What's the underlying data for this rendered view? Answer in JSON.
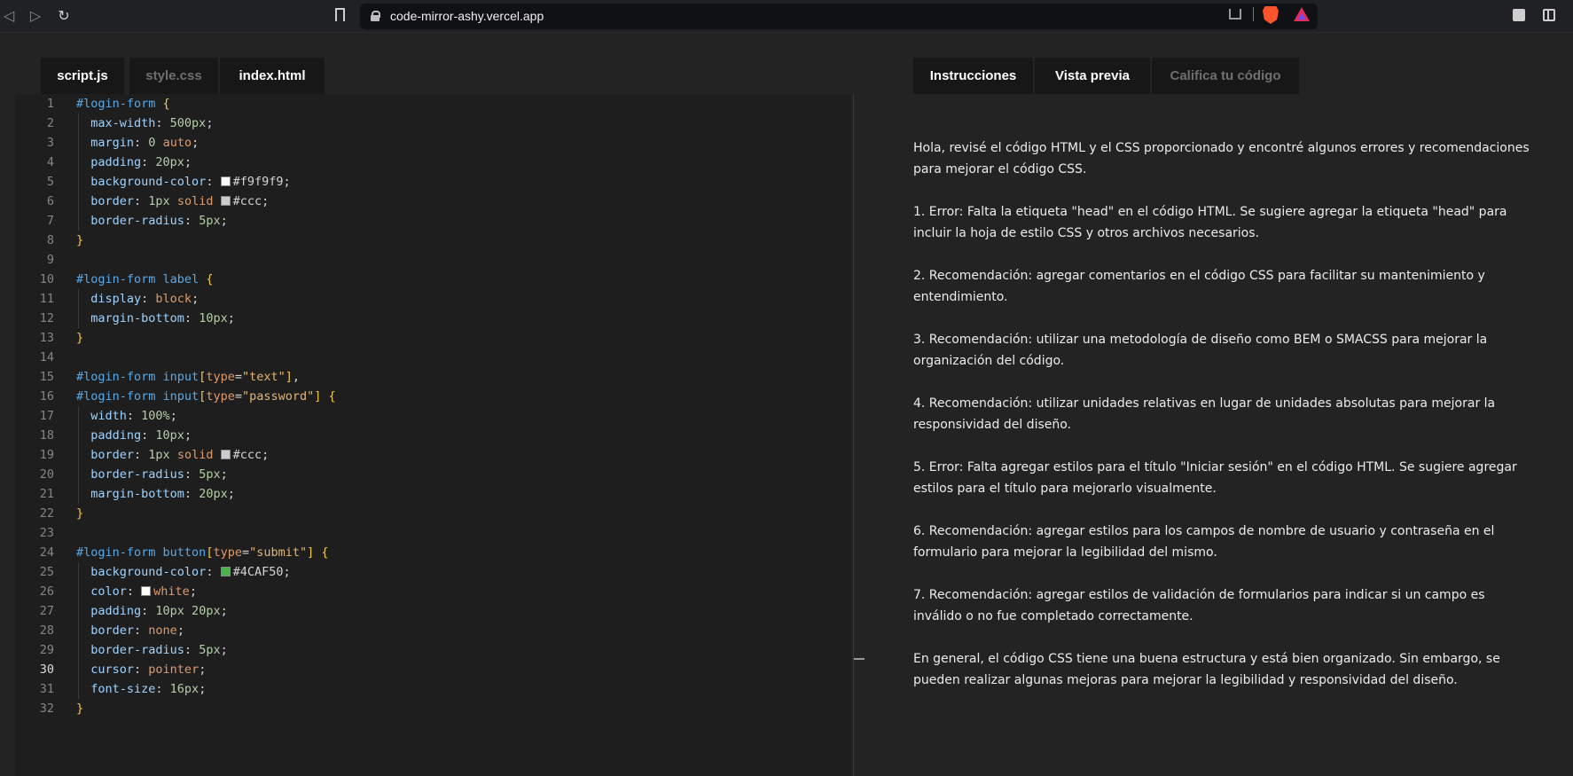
{
  "browser": {
    "url": "code-mirror-ashy.vercel.app"
  },
  "editor_tabs": [
    {
      "label": "script.js",
      "active": true
    },
    {
      "label": "style.css",
      "active": false
    },
    {
      "label": "index.html",
      "active": true
    }
  ],
  "editor": {
    "active_line": 30,
    "lines": [
      [
        [
          "sel",
          "#login-form "
        ],
        [
          "brace",
          "{"
        ]
      ],
      [
        [
          "prop",
          "  max-width"
        ],
        [
          "plain",
          ": "
        ],
        [
          "num",
          "500px"
        ],
        [
          "plain",
          ";"
        ]
      ],
      [
        [
          "prop",
          "  margin"
        ],
        [
          "plain",
          ": "
        ],
        [
          "num",
          "0 "
        ],
        [
          "kw",
          "auto"
        ],
        [
          "plain",
          ";"
        ]
      ],
      [
        [
          "prop",
          "  padding"
        ],
        [
          "plain",
          ": "
        ],
        [
          "num",
          "20px"
        ],
        [
          "plain",
          ";"
        ]
      ],
      [
        [
          "prop",
          "  background-color"
        ],
        [
          "plain",
          ": "
        ],
        [
          "swatch",
          "#f9f9f9"
        ],
        [
          "plain",
          "#f9f9f9;"
        ]
      ],
      [
        [
          "prop",
          "  border"
        ],
        [
          "plain",
          ": "
        ],
        [
          "num",
          "1px "
        ],
        [
          "kw",
          "solid "
        ],
        [
          "swatch",
          "#cccccc"
        ],
        [
          "plain",
          "#ccc;"
        ]
      ],
      [
        [
          "prop",
          "  border-radius"
        ],
        [
          "plain",
          ": "
        ],
        [
          "num",
          "5px"
        ],
        [
          "plain",
          ";"
        ]
      ],
      [
        [
          "brace",
          "}"
        ]
      ],
      [],
      [
        [
          "sel",
          "#login-form label "
        ],
        [
          "brace",
          "{"
        ]
      ],
      [
        [
          "prop",
          "  display"
        ],
        [
          "plain",
          ": "
        ],
        [
          "kw",
          "block"
        ],
        [
          "plain",
          ";"
        ]
      ],
      [
        [
          "prop",
          "  margin-bottom"
        ],
        [
          "plain",
          ": "
        ],
        [
          "num",
          "10px"
        ],
        [
          "plain",
          ";"
        ]
      ],
      [
        [
          "brace",
          "}"
        ]
      ],
      [],
      [
        [
          "sel",
          "#login-form input"
        ],
        [
          "brace",
          "["
        ],
        [
          "kw",
          "type"
        ],
        [
          "plain",
          "="
        ],
        [
          "str",
          "\"text\""
        ],
        [
          "brace",
          "]"
        ],
        [
          "plain",
          ","
        ]
      ],
      [
        [
          "sel",
          "#login-form input"
        ],
        [
          "brace",
          "["
        ],
        [
          "kw",
          "type"
        ],
        [
          "plain",
          "="
        ],
        [
          "str",
          "\"password\""
        ],
        [
          "brace",
          "] {"
        ]
      ],
      [
        [
          "prop",
          "  width"
        ],
        [
          "plain",
          ": "
        ],
        [
          "num",
          "100%"
        ],
        [
          "plain",
          ";"
        ]
      ],
      [
        [
          "prop",
          "  padding"
        ],
        [
          "plain",
          ": "
        ],
        [
          "num",
          "10px"
        ],
        [
          "plain",
          ";"
        ]
      ],
      [
        [
          "prop",
          "  border"
        ],
        [
          "plain",
          ": "
        ],
        [
          "num",
          "1px "
        ],
        [
          "kw",
          "solid "
        ],
        [
          "swatch",
          "#cccccc"
        ],
        [
          "plain",
          "#ccc;"
        ]
      ],
      [
        [
          "prop",
          "  border-radius"
        ],
        [
          "plain",
          ": "
        ],
        [
          "num",
          "5px"
        ],
        [
          "plain",
          ";"
        ]
      ],
      [
        [
          "prop",
          "  margin-bottom"
        ],
        [
          "plain",
          ": "
        ],
        [
          "num",
          "20px"
        ],
        [
          "plain",
          ";"
        ]
      ],
      [
        [
          "brace",
          "}"
        ]
      ],
      [],
      [
        [
          "sel",
          "#login-form button"
        ],
        [
          "brace",
          "["
        ],
        [
          "kw",
          "type"
        ],
        [
          "plain",
          "="
        ],
        [
          "str",
          "\"submit\""
        ],
        [
          "brace",
          "] {"
        ]
      ],
      [
        [
          "prop",
          "  background-color"
        ],
        [
          "plain",
          ": "
        ],
        [
          "swatch",
          "#4CAF50"
        ],
        [
          "plain",
          "#4CAF50;"
        ]
      ],
      [
        [
          "prop",
          "  color"
        ],
        [
          "plain",
          ": "
        ],
        [
          "swatch",
          "#ffffff"
        ],
        [
          "kw",
          "white"
        ],
        [
          "plain",
          ";"
        ]
      ],
      [
        [
          "prop",
          "  padding"
        ],
        [
          "plain",
          ": "
        ],
        [
          "num",
          "10px 20px"
        ],
        [
          "plain",
          ";"
        ]
      ],
      [
        [
          "prop",
          "  border"
        ],
        [
          "plain",
          ": "
        ],
        [
          "kw",
          "none"
        ],
        [
          "plain",
          ";"
        ]
      ],
      [
        [
          "prop",
          "  border-radius"
        ],
        [
          "plain",
          ": "
        ],
        [
          "num",
          "5px"
        ],
        [
          "plain",
          ";"
        ]
      ],
      [
        [
          "prop",
          "  cursor"
        ],
        [
          "plain",
          ": "
        ],
        [
          "kw",
          "pointer"
        ],
        [
          "plain",
          ";"
        ]
      ],
      [
        [
          "prop",
          "  font-size"
        ],
        [
          "plain",
          ": "
        ],
        [
          "num",
          "16px"
        ],
        [
          "plain",
          ";"
        ]
      ],
      [
        [
          "brace",
          "}"
        ]
      ]
    ]
  },
  "panel_tabs": [
    {
      "label": "Instrucciones",
      "active": true
    },
    {
      "label": "Vista previa",
      "active": true
    },
    {
      "label": "Califica tu código",
      "active": false
    }
  ],
  "feedback": [
    "Hola, revisé el código HTML y el CSS proporcionado y encontré algunos errores y recomendaciones para mejorar el código CSS.",
    "1. Error: Falta la etiqueta \"head\" en el código HTML. Se sugiere agregar la etiqueta \"head\" para incluir la hoja de estilo CSS y otros archivos necesarios.",
    "2. Recomendación: agregar comentarios en el código CSS para facilitar su mantenimiento y entendimiento.",
    "3. Recomendación: utilizar una metodología de diseño como BEM o SMACSS para mejorar la organización del código.",
    "4. Recomendación: utilizar unidades relativas en lugar de unidades absolutas para mejorar la responsividad del diseño.",
    "5. Error: Falta agregar estilos para el título \"Iniciar sesión\" en el código HTML. Se sugiere agregar estilos para el título para mejorarlo visualmente.",
    "6. Recomendación: agregar estilos para los campos de nombre de usuario y contraseña en el formulario para mejorar la legibilidad del mismo.",
    "7. Recomendación: agregar estilos de validación de formularios para indicar si un campo es inválido o no fue completado correctamente.",
    "En general, el código CSS tiene una buena estructura y está bien organizado. Sin embargo, se pueden realizar algunas mejoras para mejorar la legibilidad y responsividad del diseño."
  ]
}
